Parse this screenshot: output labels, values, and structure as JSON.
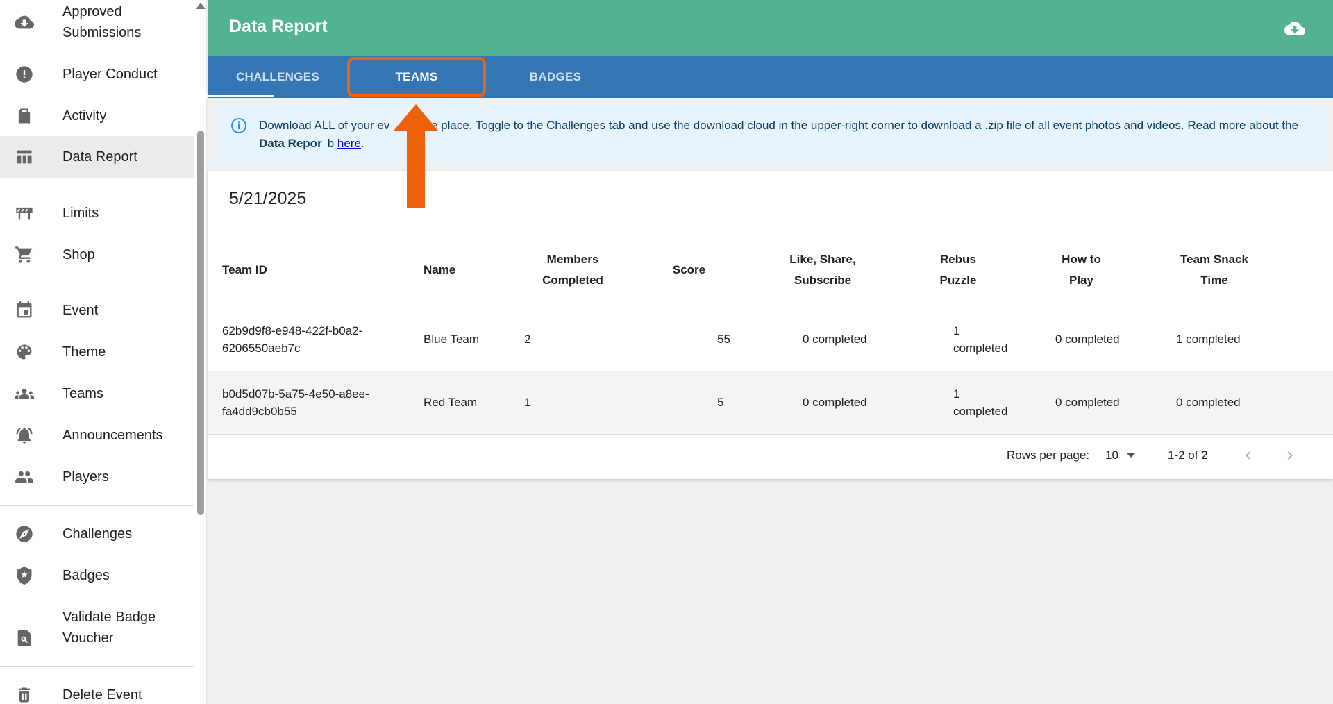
{
  "sidebar": {
    "items": [
      {
        "label": "Approved\nSubmissions",
        "icon": "cloud-download-icon"
      },
      {
        "label": "Player Conduct",
        "icon": "alert-circle-icon"
      },
      {
        "label": "Activity",
        "icon": "activity-doc-icon"
      },
      {
        "label": "Data Report",
        "icon": "table-icon",
        "active": true
      },
      {
        "label": "Limits",
        "icon": "barrier-icon"
      },
      {
        "label": "Shop",
        "icon": "cart-icon"
      },
      {
        "label": "Event",
        "icon": "calendar-icon"
      },
      {
        "label": "Theme",
        "icon": "palette-icon"
      },
      {
        "label": "Teams",
        "icon": "teams-icon"
      },
      {
        "label": "Announcements",
        "icon": "alarm-bell-icon"
      },
      {
        "label": "Players",
        "icon": "people-icon"
      },
      {
        "label": "Challenges",
        "icon": "compass-icon"
      },
      {
        "label": "Badges",
        "icon": "shield-star-icon"
      },
      {
        "label": "Validate Badge\nVoucher",
        "icon": "search-doc-icon"
      },
      {
        "label": "Delete Event",
        "icon": "trash-icon"
      }
    ]
  },
  "header": {
    "title": "Data Report",
    "download_icon": "cloud-download-icon"
  },
  "tabs": [
    {
      "label": "CHALLENGES",
      "active": false
    },
    {
      "label": "TEAMS",
      "active": true
    },
    {
      "label": "BADGES",
      "active": false
    }
  ],
  "info": {
    "text_1": "Download ALL of your ev",
    "text_2": " in one place. Toggle to the Challenges tab and use the download cloud in the upper-right corner to download a .zip file of all event photos and videos. Read more about the ",
    "bold": "Data Repor",
    "text_3": "b ",
    "link": "here",
    "text_4": "."
  },
  "report": {
    "date": "5/21/2025",
    "columns": [
      "Team ID",
      "Name",
      "Members\nCompleted",
      "Score",
      "Like, Share,\nSubscribe",
      "Rebus\nPuzzle",
      "How to\nPlay",
      "Team Snack\nTime"
    ],
    "rows": [
      [
        "62b9d9f8-e948-422f-b0a2-\n6206550aeb7c",
        "Blue Team",
        "2",
        "55",
        "0 completed",
        "1 completed",
        "0 completed",
        "1 completed"
      ],
      [
        "b0d5d07b-5a75-4e50-a8ee-\nfa4dd9cb0b55",
        "Red Team",
        "1",
        "5",
        "0 completed",
        "1 completed",
        "0 completed",
        "0 completed"
      ]
    ]
  },
  "pagination": {
    "rows_per_page_label": "Rows per page:",
    "rows_per_page_value": "10",
    "range": "1-2 of 2"
  },
  "colors": {
    "header_green": "#52b394",
    "tab_blue": "#3476b4",
    "highlight_orange": "#f0620a",
    "info_bg": "#e8f4fd"
  }
}
